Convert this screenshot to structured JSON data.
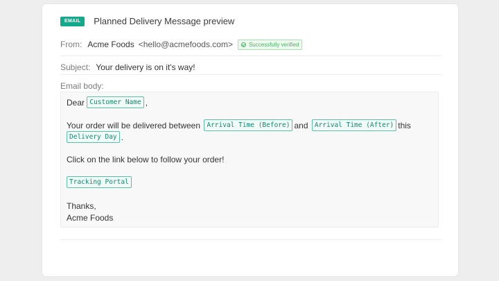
{
  "header": {
    "badge": "EMAIL",
    "title": "Planned Delivery Message preview"
  },
  "from": {
    "label": "From:",
    "name": "Acme Foods",
    "email": "<hello@acmefoods.com>",
    "verified_text": "Successfully verified"
  },
  "subject": {
    "label": "Subject:",
    "value": "Your delivery is on it's way!"
  },
  "email_body": {
    "label": "Email body:",
    "greeting": "Dear",
    "customer_name_token": "Customer Name",
    "greeting_punct": ",",
    "delivery_text_1": "Your order will be delivered between",
    "arrival_before_token": "Arrival Time (Before)",
    "delivery_and": "and",
    "arrival_after_token": "Arrival Time (After)",
    "delivery_this": "this",
    "delivery_day_token": "Delivery Day",
    "delivery_period": ".",
    "link_text": "Click on the link below to follow your order!",
    "tracking_token": "Tracking Portal",
    "signoff": "Thanks,",
    "signature": "Acme Foods"
  },
  "colors": {
    "badge": "#13a98a",
    "token_border": "#5cc0a8",
    "token_text": "#16866e",
    "verified": "#4caf68"
  }
}
